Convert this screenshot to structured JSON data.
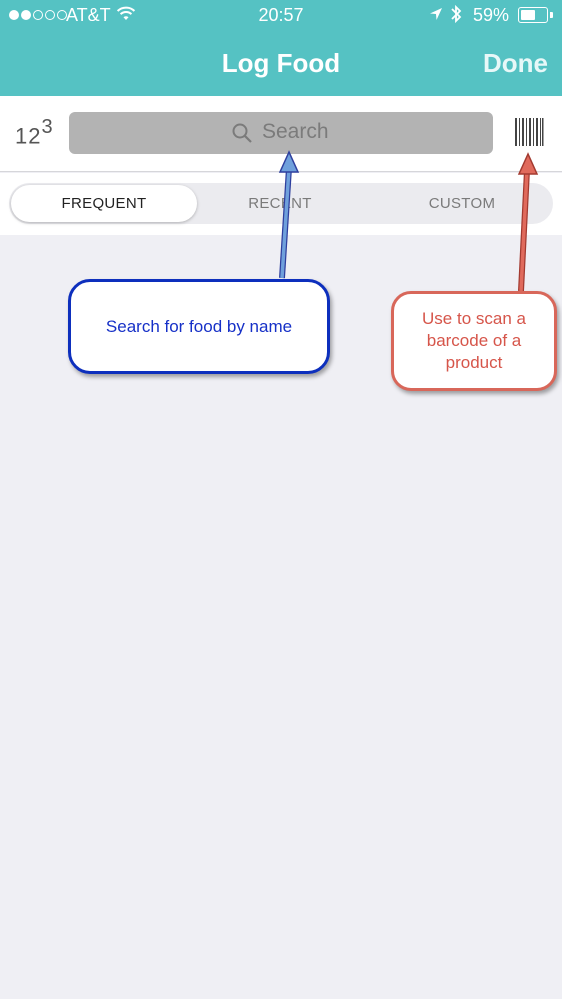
{
  "status_bar": {
    "signal_dots_filled": 2,
    "signal_dots_total": 5,
    "carrier": "AT&T",
    "time": "20:57",
    "battery_text": "59%",
    "battery_level": 0.59
  },
  "nav": {
    "title": "Log Food",
    "done_label": "Done"
  },
  "search": {
    "numpad_base": "12",
    "numpad_sup": "3",
    "placeholder": "Search",
    "barcode_icon": "barcode-icon"
  },
  "tabs": [
    {
      "label": "FREQUENT",
      "active": true
    },
    {
      "label": "RECENT",
      "active": false
    },
    {
      "label": "CUSTOM",
      "active": false
    }
  ],
  "annotations": {
    "search_note": "Search for food by name",
    "barcode_note": "Use to scan a barcode of a product"
  },
  "colors": {
    "header": "#55c2c3",
    "background": "#efeff4",
    "annotation_blue": "#0d2fbd",
    "annotation_red": "#d8675a"
  }
}
